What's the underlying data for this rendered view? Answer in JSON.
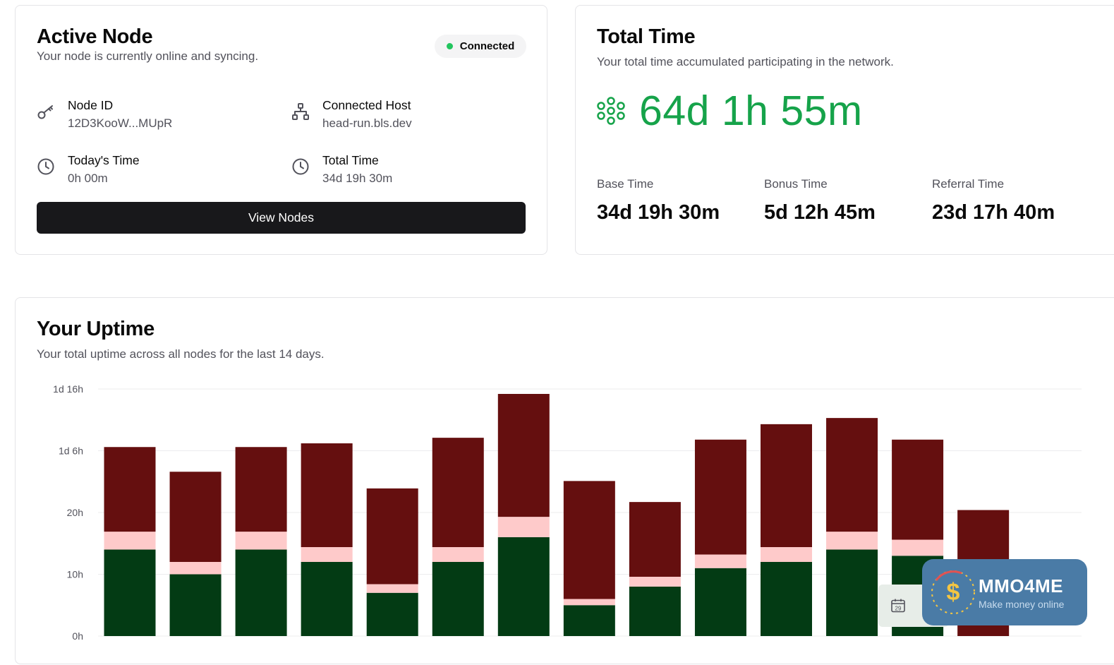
{
  "active_node": {
    "title": "Active Node",
    "subtitle": "Your node is currently online and syncing.",
    "status": "Connected",
    "status_color": "#22c55e",
    "node_id_label": "Node ID",
    "node_id_value": "12D3KooW...MUpR",
    "host_label": "Connected Host",
    "host_value": "head-run.bls.dev",
    "today_label": "Today's Time",
    "today_value": "0h 00m",
    "total_label": "Total Time",
    "total_value": "34d 19h 30m",
    "button_label": "View Nodes"
  },
  "total_time": {
    "title": "Total Time",
    "subtitle": "Your total time accumulated participating in the network.",
    "value": "64d 1h 55m",
    "accent_color": "#16a34a",
    "stats": [
      {
        "label": "Base Time",
        "value": "34d 19h 30m"
      },
      {
        "label": "Bonus Time",
        "value": "5d 12h 45m"
      },
      {
        "label": "Referral Time",
        "value": "23d 17h 40m"
      }
    ]
  },
  "uptime": {
    "title": "Your Uptime",
    "subtitle": "Your total uptime across all nodes for the last 14 days."
  },
  "chart_data": {
    "type": "bar",
    "stacked": true,
    "y_unit": "hours",
    "ylim": [
      0,
      40
    ],
    "yticks": [
      0,
      10,
      20,
      30,
      40
    ],
    "ytick_labels": [
      "0h",
      "10h",
      "20h",
      "1d 6h",
      "1d 16h"
    ],
    "grid": true,
    "series": [
      {
        "color": "#033b14",
        "values": [
          14,
          10,
          14,
          12,
          7,
          12,
          16,
          5,
          8,
          11,
          12,
          14,
          13,
          0
        ]
      },
      {
        "color": "#fecaca",
        "values": [
          2.9,
          2,
          2.9,
          2.4,
          1.4,
          2.4,
          3.3,
          1,
          1.6,
          2.2,
          2.4,
          2.9,
          2.6,
          0
        ]
      },
      {
        "color": "#650f0f",
        "values": [
          13.7,
          14.6,
          13.7,
          16.8,
          15.5,
          17.7,
          19.9,
          19.1,
          12.1,
          18.6,
          19.9,
          18.4,
          16.2,
          20.4
        ]
      }
    ]
  },
  "overlay": {
    "calendar_day": "29",
    "brand": "MMO4ME",
    "tagline": "Make money online"
  }
}
